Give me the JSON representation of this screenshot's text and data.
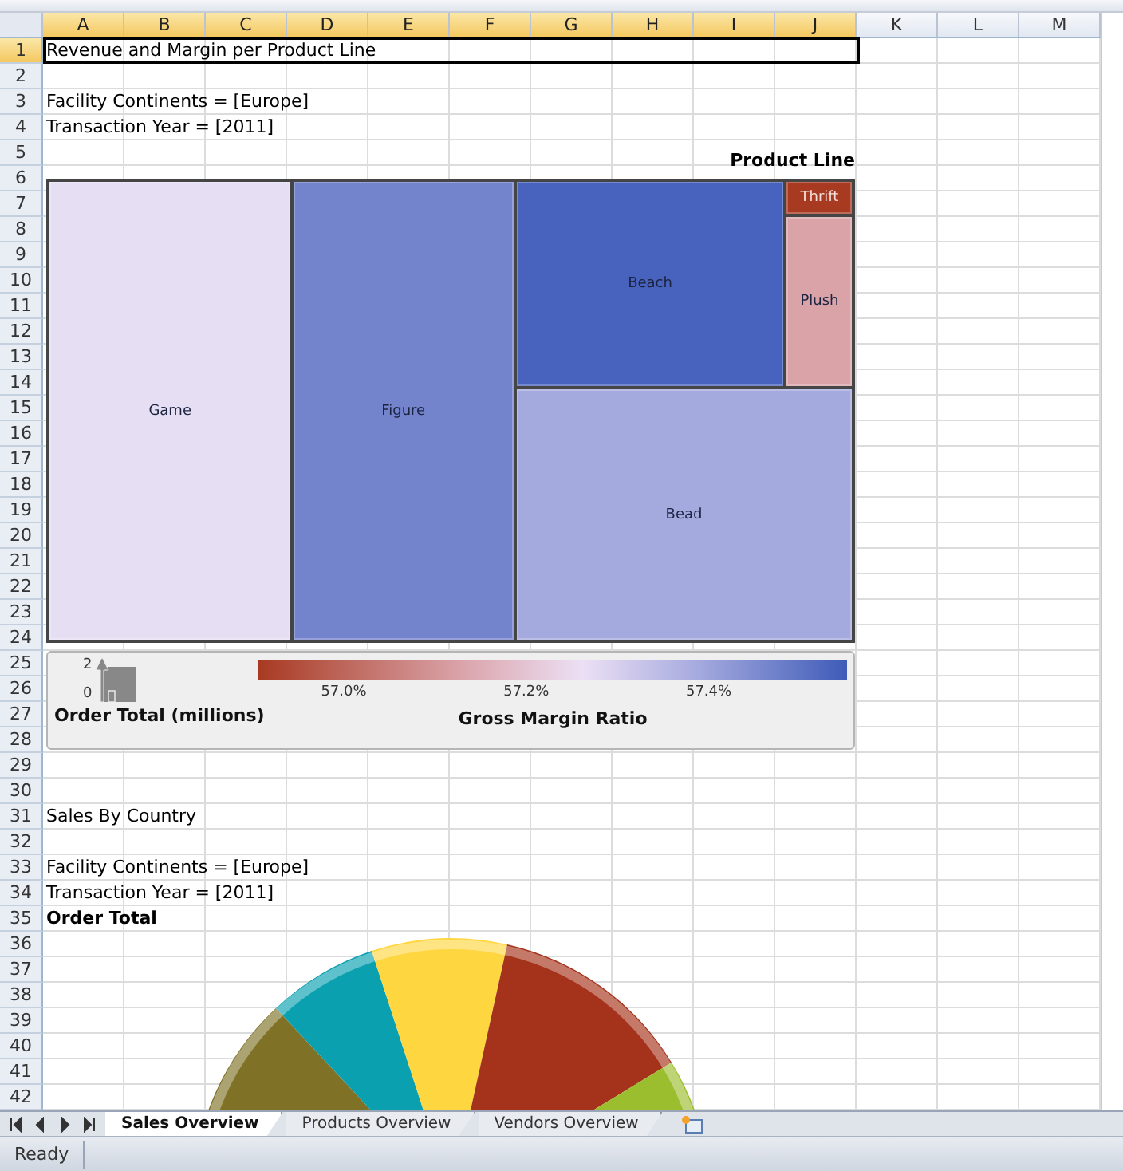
{
  "columns": [
    {
      "label": "A",
      "selected": true
    },
    {
      "label": "B",
      "selected": true
    },
    {
      "label": "C",
      "selected": true
    },
    {
      "label": "D",
      "selected": true
    },
    {
      "label": "E",
      "selected": true
    },
    {
      "label": "F",
      "selected": true
    },
    {
      "label": "G",
      "selected": true
    },
    {
      "label": "H",
      "selected": true
    },
    {
      "label": "I",
      "selected": true
    },
    {
      "label": "J",
      "selected": true
    },
    {
      "label": "K",
      "selected": false
    },
    {
      "label": "L",
      "selected": false
    },
    {
      "label": "M",
      "selected": false
    }
  ],
  "rows": [
    {
      "number": "1",
      "selected": true,
      "text": "Revenue and Margin per Product Line"
    },
    {
      "number": "2",
      "selected": false
    },
    {
      "number": "3",
      "selected": false,
      "text": "Facility Continents = [Europe]"
    },
    {
      "number": "4",
      "selected": false,
      "text": "Transaction Year = [2011]"
    },
    {
      "number": "5",
      "selected": false
    },
    {
      "number": "6",
      "selected": false
    },
    {
      "number": "7",
      "selected": false
    },
    {
      "number": "8",
      "selected": false
    },
    {
      "number": "9",
      "selected": false
    },
    {
      "number": "10",
      "selected": false
    },
    {
      "number": "11",
      "selected": false
    },
    {
      "number": "12",
      "selected": false
    },
    {
      "number": "13",
      "selected": false
    },
    {
      "number": "14",
      "selected": false
    },
    {
      "number": "15",
      "selected": false
    },
    {
      "number": "16",
      "selected": false
    },
    {
      "number": "17",
      "selected": false
    },
    {
      "number": "18",
      "selected": false
    },
    {
      "number": "19",
      "selected": false
    },
    {
      "number": "20",
      "selected": false
    },
    {
      "number": "21",
      "selected": false
    },
    {
      "number": "22",
      "selected": false
    },
    {
      "number": "23",
      "selected": false
    },
    {
      "number": "24",
      "selected": false
    },
    {
      "number": "25",
      "selected": false
    },
    {
      "number": "26",
      "selected": false
    },
    {
      "number": "27",
      "selected": false
    },
    {
      "number": "28",
      "selected": false
    },
    {
      "number": "29",
      "selected": false
    },
    {
      "number": "30",
      "selected": false
    },
    {
      "number": "31",
      "selected": false,
      "text": "Sales By Country"
    },
    {
      "number": "32",
      "selected": false
    },
    {
      "number": "33",
      "selected": false,
      "text": "Facility Continents = [Europe]"
    },
    {
      "number": "34",
      "selected": false,
      "text": "Transaction Year = [2011]"
    },
    {
      "number": "35",
      "selected": false
    },
    {
      "number": "36",
      "selected": false
    },
    {
      "number": "37",
      "selected": false
    },
    {
      "number": "38",
      "selected": false
    },
    {
      "number": "39",
      "selected": false
    },
    {
      "number": "40",
      "selected": false
    },
    {
      "number": "41",
      "selected": false
    },
    {
      "number": "42",
      "selected": false
    }
  ],
  "treemap": {
    "title": "Product Line",
    "items": [
      {
        "label": "Game",
        "color": "#e6dff3"
      },
      {
        "label": "Figure",
        "color": "#7383cc"
      },
      {
        "label": "Beach",
        "color": "#4763bd"
      },
      {
        "label": "Thrift",
        "color": "#a83a22"
      },
      {
        "label": "Plush",
        "color": "#d9a3a8"
      },
      {
        "label": "Bead",
        "color": "#a4a9de"
      }
    ]
  },
  "legend": {
    "size_title": "Order Total (millions)",
    "size_ticks": [
      "2",
      "0"
    ],
    "color_title": "Gross Margin Ratio",
    "color_ticks": [
      "57.0%",
      "57.2%",
      "57.4%"
    ]
  },
  "pie": {
    "title": "Order Total"
  },
  "sheet_tabs": [
    {
      "label": "Sales Overview",
      "selected": true
    },
    {
      "label": "Products Overview",
      "selected": false
    },
    {
      "label": "Vendors Overview",
      "selected": false
    }
  ],
  "status_bar": {
    "text": "Ready"
  }
}
